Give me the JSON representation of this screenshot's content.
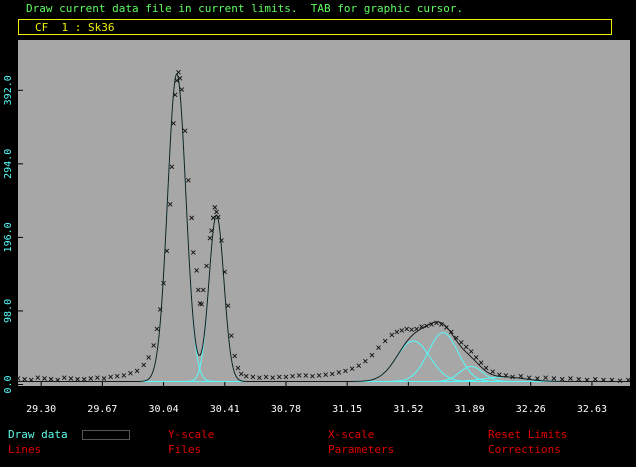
{
  "header": {
    "status_line": "Draw current data file in current limits.  TAB for graphic cursor.",
    "file_label": "CF  1 : Sk36"
  },
  "menu": {
    "items": [
      {
        "label": "Draw data",
        "active": true
      },
      {
        "label": "Y-scale"
      },
      {
        "label": "X-scale"
      },
      {
        "label": "Reset Limits"
      },
      {
        "label": "Lines"
      },
      {
        "label": "Files"
      },
      {
        "label": "Parameters"
      },
      {
        "label": "Corrections"
      }
    ]
  },
  "colors": {
    "plot_bg": "#a7a7a7",
    "fit_component": "#54fcfc",
    "total_fit": "#1a1a1a",
    "data_marker": "#111111",
    "status_text": "#5efc5e",
    "file_label": "#f0f000",
    "menu_text": "#e00000",
    "menu_active": "#5efce8"
  },
  "chart_data": {
    "type": "line",
    "xlim": [
      29.16,
      32.86
    ],
    "ylim": [
      -2,
      459
    ],
    "x_ticks": [
      "29.30",
      "29.67",
      "30.04",
      "30.41",
      "30.78",
      "31.15",
      "31.52",
      "31.89",
      "32.26",
      "32.63"
    ],
    "y_ticks": [
      "0.0",
      "98.0",
      "196.0",
      "294.0",
      "392.0"
    ],
    "baseline": 4,
    "components": [
      {
        "name": "",
        "center": 30.12,
        "amplitude": 410,
        "sigma": 0.055
      },
      {
        "name": "",
        "center": 30.36,
        "amplitude": 222,
        "sigma": 0.045
      },
      {
        "name": "",
        "center": 31.55,
        "amplitude": 54,
        "sigma": 0.1
      },
      {
        "name": "",
        "center": 31.73,
        "amplitude": 65,
        "sigma": 0.09
      },
      {
        "name": "",
        "center": 31.9,
        "amplitude": 20,
        "sigma": 0.07
      },
      {
        "name": "",
        "center": 32.1,
        "amplitude": 6,
        "sigma": 0.12
      }
    ],
    "data_points": [
      [
        29.16,
        8
      ],
      [
        29.2,
        7
      ],
      [
        29.24,
        6
      ],
      [
        29.28,
        9
      ],
      [
        29.32,
        8
      ],
      [
        29.36,
        7
      ],
      [
        29.4,
        6
      ],
      [
        29.44,
        9
      ],
      [
        29.48,
        8
      ],
      [
        29.52,
        7
      ],
      [
        29.56,
        7
      ],
      [
        29.6,
        8
      ],
      [
        29.64,
        9
      ],
      [
        29.68,
        8
      ],
      [
        29.72,
        10
      ],
      [
        29.76,
        11
      ],
      [
        29.8,
        12
      ],
      [
        29.84,
        15
      ],
      [
        29.88,
        18
      ],
      [
        29.92,
        26
      ],
      [
        29.95,
        36
      ],
      [
        29.98,
        52
      ],
      [
        30.0,
        74
      ],
      [
        30.02,
        100
      ],
      [
        30.04,
        135
      ],
      [
        30.06,
        178
      ],
      [
        30.08,
        240
      ],
      [
        30.09,
        290
      ],
      [
        30.1,
        348
      ],
      [
        30.11,
        386
      ],
      [
        30.12,
        405
      ],
      [
        30.13,
        416
      ],
      [
        30.14,
        408
      ],
      [
        30.15,
        393
      ],
      [
        30.17,
        338
      ],
      [
        30.19,
        272
      ],
      [
        30.21,
        222
      ],
      [
        30.22,
        176
      ],
      [
        30.24,
        152
      ],
      [
        30.25,
        126
      ],
      [
        30.26,
        108
      ],
      [
        30.27,
        107
      ],
      [
        30.28,
        126
      ],
      [
        30.3,
        158
      ],
      [
        30.32,
        195
      ],
      [
        30.33,
        205
      ],
      [
        30.34,
        222
      ],
      [
        30.35,
        236
      ],
      [
        30.36,
        230
      ],
      [
        30.37,
        223
      ],
      [
        30.39,
        192
      ],
      [
        30.41,
        150
      ],
      [
        30.43,
        105
      ],
      [
        30.45,
        65
      ],
      [
        30.47,
        38
      ],
      [
        30.49,
        22
      ],
      [
        30.51,
        14
      ],
      [
        30.54,
        11
      ],
      [
        30.58,
        10
      ],
      [
        30.62,
        9
      ],
      [
        30.66,
        10
      ],
      [
        30.7,
        9
      ],
      [
        30.74,
        10
      ],
      [
        30.78,
        10
      ],
      [
        30.82,
        11
      ],
      [
        30.86,
        12
      ],
      [
        30.9,
        12
      ],
      [
        30.94,
        11
      ],
      [
        30.98,
        12
      ],
      [
        31.02,
        13
      ],
      [
        31.06,
        14
      ],
      [
        31.1,
        16
      ],
      [
        31.14,
        18
      ],
      [
        31.18,
        21
      ],
      [
        31.22,
        25
      ],
      [
        31.26,
        31
      ],
      [
        31.3,
        39
      ],
      [
        31.34,
        49
      ],
      [
        31.38,
        58
      ],
      [
        31.42,
        66
      ],
      [
        31.45,
        70
      ],
      [
        31.48,
        72
      ],
      [
        31.51,
        74
      ],
      [
        31.54,
        73
      ],
      [
        31.57,
        74
      ],
      [
        31.6,
        77
      ],
      [
        31.63,
        78
      ],
      [
        31.66,
        80
      ],
      [
        31.69,
        82
      ],
      [
        31.72,
        80
      ],
      [
        31.75,
        76
      ],
      [
        31.78,
        70
      ],
      [
        31.81,
        62
      ],
      [
        31.84,
        56
      ],
      [
        31.87,
        50
      ],
      [
        31.9,
        44
      ],
      [
        31.93,
        36
      ],
      [
        31.96,
        29
      ],
      [
        31.99,
        22
      ],
      [
        32.03,
        17
      ],
      [
        32.07,
        13
      ],
      [
        32.11,
        12
      ],
      [
        32.15,
        10
      ],
      [
        32.2,
        11
      ],
      [
        32.25,
        9
      ],
      [
        32.3,
        8
      ],
      [
        32.35,
        9
      ],
      [
        32.4,
        8
      ],
      [
        32.45,
        7
      ],
      [
        32.5,
        8
      ],
      [
        32.55,
        7
      ],
      [
        32.6,
        6
      ],
      [
        32.65,
        7
      ],
      [
        32.7,
        6
      ],
      [
        32.75,
        6
      ],
      [
        32.8,
        5
      ],
      [
        32.85,
        6
      ]
    ]
  }
}
